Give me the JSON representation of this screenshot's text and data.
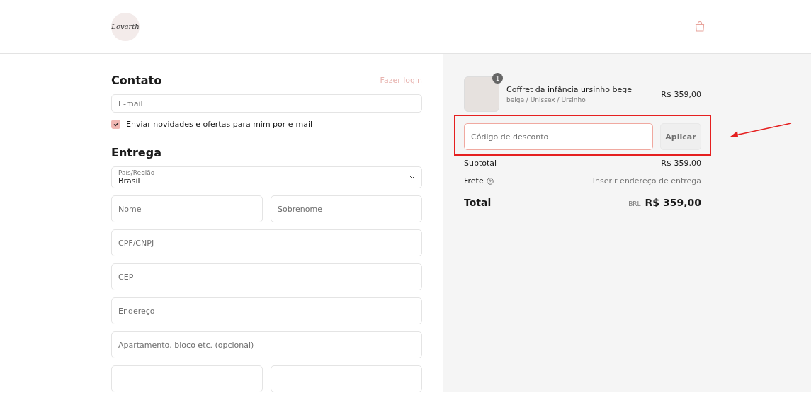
{
  "header": {
    "logo_text": "Lovarth"
  },
  "contact": {
    "title": "Contato",
    "login_link": "Fazer login",
    "email": {
      "placeholder": "E-mail"
    },
    "newsletter": {
      "label": "Enviar novidades e ofertas para mim por e-mail",
      "checked": true
    }
  },
  "delivery": {
    "title": "Entrega",
    "country": {
      "label": "País/Região",
      "value": "Brasil"
    },
    "rows": [
      [
        {
          "placeholder": "Nome"
        },
        {
          "placeholder": "Sobrenome"
        }
      ],
      [
        {
          "placeholder": "CPF/CNPJ"
        }
      ],
      [
        {
          "placeholder": "CEP"
        }
      ],
      [
        {
          "placeholder": "Endereço"
        }
      ],
      [
        {
          "placeholder": "Apartamento, bloco etc. (opcional)"
        }
      ],
      [
        {},
        {}
      ]
    ]
  },
  "summary": {
    "item": {
      "quantity": "1",
      "name": "Coffret da infância ursinho bege",
      "variant": "beige / Unissex / Ursinho",
      "price": "R$ 359,00"
    },
    "discount": {
      "placeholder": "Código de desconto",
      "button": "Aplicar"
    },
    "lines": [
      {
        "label": "Subtotal",
        "value": "R$ 359,00",
        "kind": "amount"
      },
      {
        "label": "Frete",
        "value": "Inserir endereço de entrega",
        "kind": "hint"
      }
    ],
    "total": {
      "label": "Total",
      "currency": "BRL",
      "value": "R$ 359,00"
    }
  }
}
